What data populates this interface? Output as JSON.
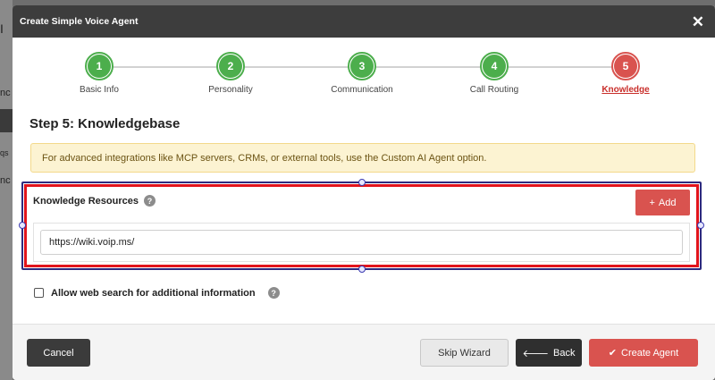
{
  "background": {
    "fragments": [
      "I",
      "nc",
      "qs",
      "nc"
    ]
  },
  "modal": {
    "title": "Create Simple Voice Agent",
    "close_glyph": "✕"
  },
  "stepper": {
    "steps": [
      {
        "number": "1",
        "label": "Basic Info",
        "state": "done"
      },
      {
        "number": "2",
        "label": "Personality",
        "state": "done"
      },
      {
        "number": "3",
        "label": "Communication",
        "state": "done"
      },
      {
        "number": "4",
        "label": "Call Routing",
        "state": "done"
      },
      {
        "number": "5",
        "label": "Knowledge",
        "state": "active"
      }
    ]
  },
  "section_title": "Step 5: Knowledgebase",
  "alert_text": "For advanced integrations like MCP servers, CRMs, or external tools, use the Custom AI Agent option.",
  "knowledge": {
    "title": "Knowledge Resources",
    "help_glyph": "?",
    "add_icon": "+",
    "add_label": "Add",
    "url_value": "https://wiki.voip.ms/"
  },
  "web_search": {
    "label": "Allow web search for additional information",
    "checked": false,
    "help_glyph": "?"
  },
  "footer": {
    "cancel_label": "Cancel",
    "skip_label": "Skip Wizard",
    "back_icon": "🡐",
    "back_label": "Back",
    "create_icon": "✔",
    "create_label": "Create Agent"
  },
  "colors": {
    "header_bg": "#3d3d3d",
    "step_done": "#4cae4c",
    "step_active": "#d9534f",
    "primary_red": "#d9534f",
    "highlight_red": "#e2141c",
    "highlight_blue": "#2d2b7f",
    "alert_bg": "#fcf3d2"
  }
}
